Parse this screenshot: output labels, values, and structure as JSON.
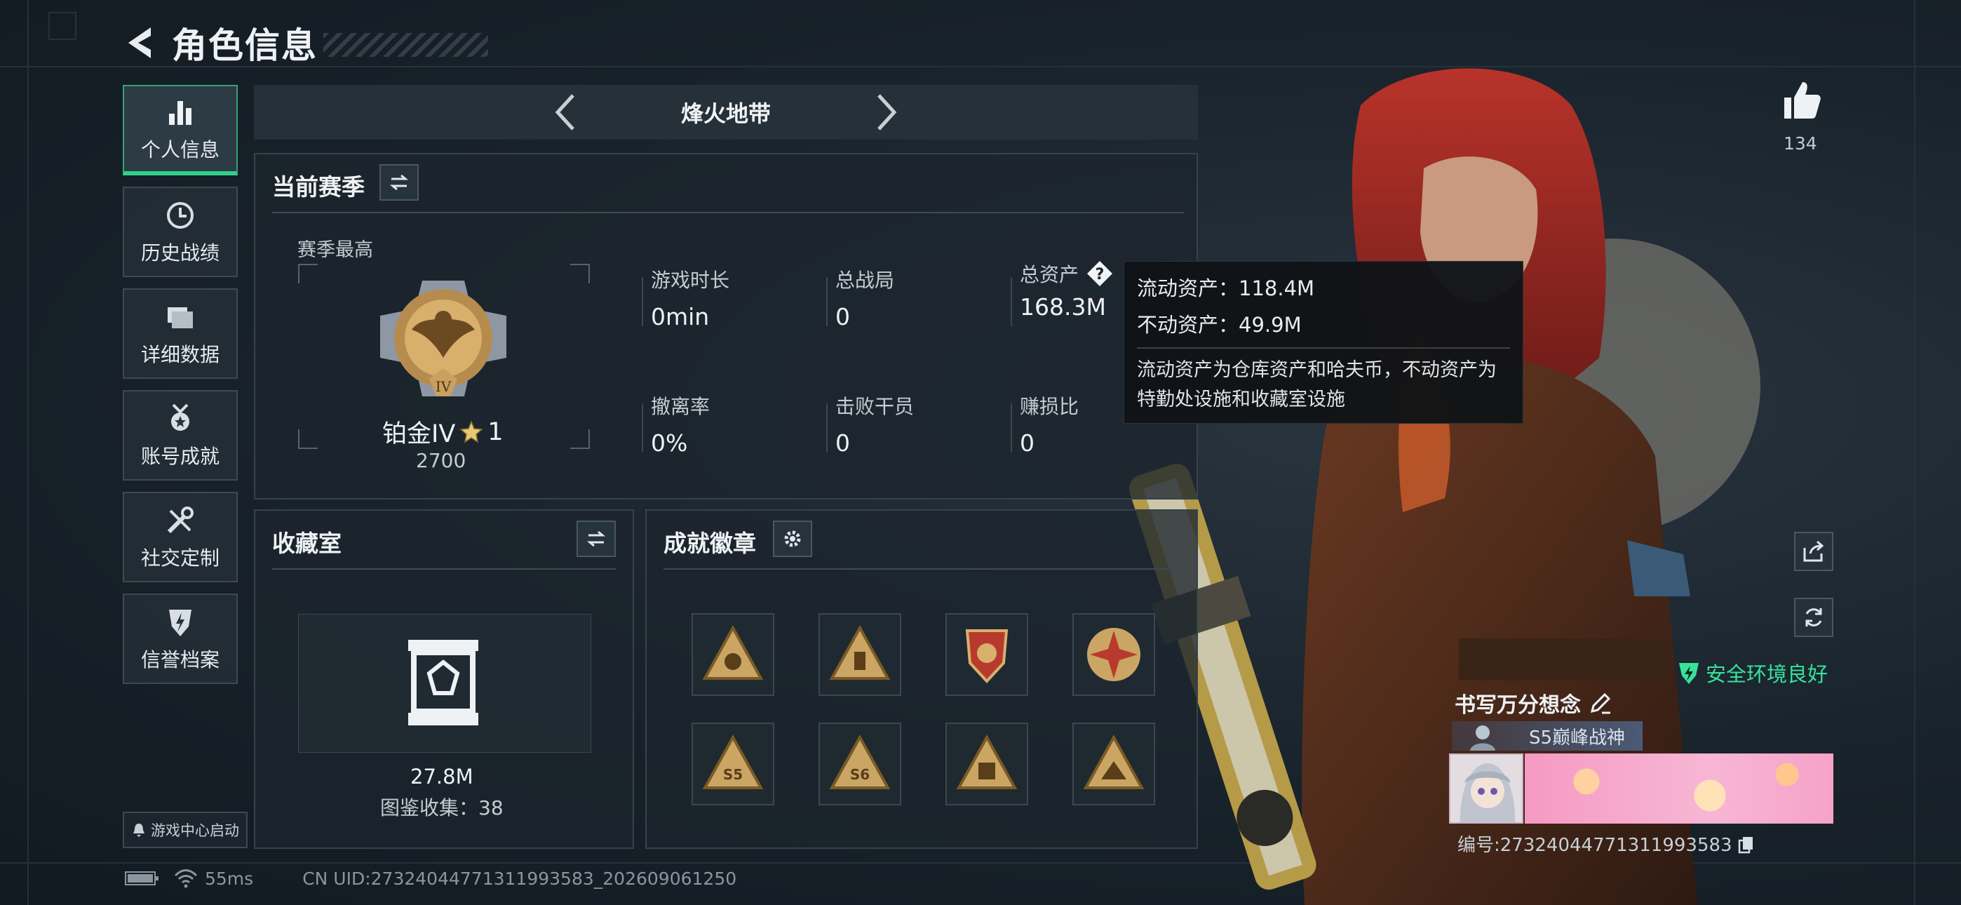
{
  "header": {
    "title": "角色信息"
  },
  "nav": {
    "items": [
      {
        "label": "个人信息",
        "icon": "bar-chart-icon",
        "active": true
      },
      {
        "label": "历史战绩",
        "icon": "history-clock-icon",
        "active": false
      },
      {
        "label": "详细数据",
        "icon": "folder-icon",
        "active": false
      },
      {
        "label": "账号成就",
        "icon": "medal-icon",
        "active": false
      },
      {
        "label": "社交定制",
        "icon": "tools-icon",
        "active": false
      },
      {
        "label": "信誉档案",
        "icon": "shield-bolt-icon",
        "active": false
      }
    ],
    "game_center": "游戏中心启动"
  },
  "mode": {
    "title": "烽火地带"
  },
  "season": {
    "title": "当前赛季",
    "peak_label": "赛季最高",
    "rank": "铂金IV",
    "stars": "1",
    "points": "2700",
    "stats": [
      {
        "label": "游戏时长",
        "value": "0min"
      },
      {
        "label": "总战局",
        "value": "0"
      },
      {
        "label": "总资产",
        "value": "168.3M"
      },
      {
        "label": "撤离率",
        "value": "0%"
      },
      {
        "label": "击败干员",
        "value": "0"
      },
      {
        "label": "赚损比",
        "value": "0"
      }
    ]
  },
  "tooltip": {
    "liquid": "流动资产：118.4M",
    "fixed": "不动资产：49.9M",
    "note": "流动资产为仓库资产和哈夫币，不动资产为特勤处设施和收藏室设施"
  },
  "collection": {
    "title": "收藏室",
    "value": "27.8M",
    "count_label": "图鉴收集：38"
  },
  "badges": {
    "title": "成就徽章",
    "items": [
      "gold-triangle-badge",
      "gold-triangle-badge",
      "red-shield-badge",
      "red-star-badge",
      "s5-triangle-badge",
      "s6-triangle-badge",
      "gold-triangle-badge",
      "gold-triangle-badge"
    ]
  },
  "social": {
    "likes": "134"
  },
  "player": {
    "safety": "安全环境良好",
    "name": "书写万分想念",
    "title_badge": "S5巅峰战神",
    "id": "编号:27324044771311993583"
  },
  "footer": {
    "ping": "55ms",
    "uid": "CN UID:27324044771311993583_202609061250"
  },
  "colors": {
    "accent": "#2fd08a",
    "safe": "#35e39a",
    "bg": "#182129"
  }
}
